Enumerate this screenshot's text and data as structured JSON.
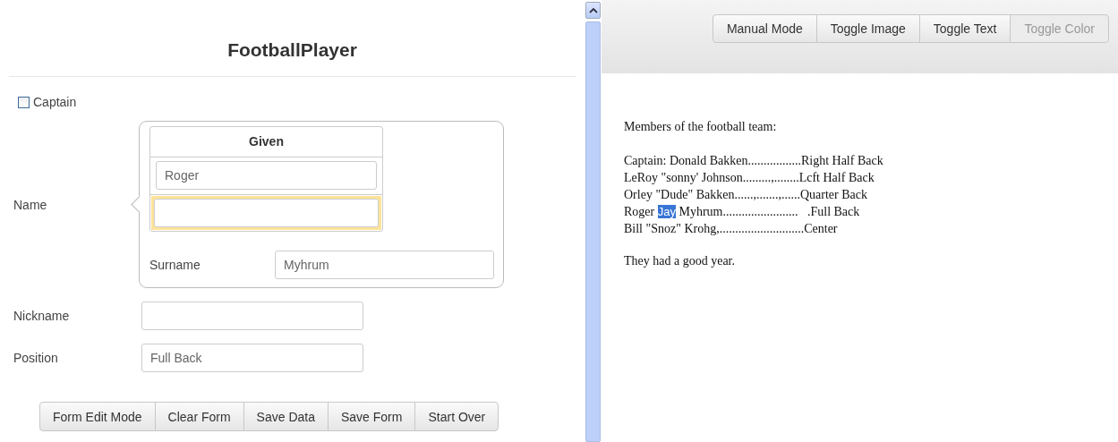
{
  "form": {
    "title": "FootballPlayer",
    "captain": {
      "label": "Captain",
      "checked": false
    },
    "name": {
      "label": "Name",
      "given": {
        "header": "Given",
        "fields": [
          {
            "value": "Roger",
            "focused": false
          },
          {
            "focused": true
          }
        ]
      },
      "surname": {
        "label": "Surname",
        "value": "Myhrum"
      }
    },
    "fields": [
      {
        "label": "Nickname"
      },
      {
        "label": "Position",
        "value": "Full Back"
      }
    ],
    "buttons": [
      {
        "label": "Form Edit Mode",
        "disabled": false
      },
      {
        "label": "Clear Form",
        "disabled": false
      },
      {
        "label": "Save Data",
        "disabled": false
      },
      {
        "label": "Save Form",
        "disabled": false
      },
      {
        "label": "Start Over",
        "disabled": false
      }
    ]
  },
  "toolbar": {
    "buttons": [
      {
        "label": "Manual Mode",
        "disabled": false
      },
      {
        "label": "Toggle Image",
        "disabled": false
      },
      {
        "label": "Toggle Text",
        "disabled": false
      },
      {
        "label": "Toggle Color",
        "disabled": true
      }
    ]
  },
  "document": {
    "heading": "Members of the football team:",
    "lines": [
      {
        "before": "Captain: Donald Bakken.................Right Half Back"
      },
      {
        "before": "LeRoy \"sonny' Johnson.........,........Lcft Half Back"
      },
      {
        "before": "Orley \"Dude\" Bakken......,.......,......Quarter Back"
      },
      {
        "before": "Roger ",
        "selected": "Jay",
        "after": " Myhrum........................   .Full Back"
      },
      {
        "before": "Bill \"Snoz\" Krohg,...........................Center"
      }
    ],
    "closing": "They had a good year."
  }
}
